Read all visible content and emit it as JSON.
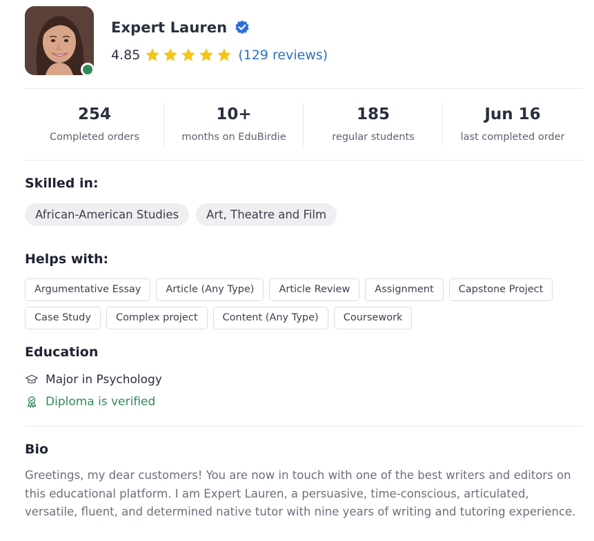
{
  "profile": {
    "name": "Expert Lauren",
    "rating": "4.85",
    "stars": 5,
    "reviews": "(129 reviews)",
    "online": true
  },
  "stats": [
    {
      "value": "254",
      "label": "Completed orders"
    },
    {
      "value": "10+",
      "label": "months on EduBirdie"
    },
    {
      "value": "185",
      "label": "regular students"
    },
    {
      "value": "Jun 16",
      "label": "last completed order"
    }
  ],
  "skilled": {
    "title": "Skilled in:",
    "items": [
      "African-American Studies",
      "Art, Theatre and Film"
    ]
  },
  "helps": {
    "title": "Helps with:",
    "row1": [
      "Argumentative Essay",
      "Article (Any Type)",
      "Article Review",
      "Assignment",
      "Capstone Project"
    ],
    "row2": [
      "Case Study",
      "Complex project",
      "Content (Any Type)",
      "Coursework"
    ]
  },
  "education": {
    "title": "Education",
    "major": "Major in Psychology",
    "diploma": "Diploma is verified"
  },
  "bio": {
    "title": "Bio",
    "text": "Greetings, my dear customers! You are now in touch with one of the best writers and editors on this educational platform. I am Expert Lauren, a persuasive, time-conscious, articulated, versatile, fluent, and determined native tutor with nine years of writing and tutoring experience."
  },
  "colors": {
    "accent": "#2d6fbf",
    "verified_green": "#2e8a59",
    "star": "#f5c518",
    "badge_blue": "#2b6fd6"
  },
  "icons": [
    "verified-badge-icon",
    "star-icon",
    "graduation-cap-icon",
    "award-icon"
  ]
}
